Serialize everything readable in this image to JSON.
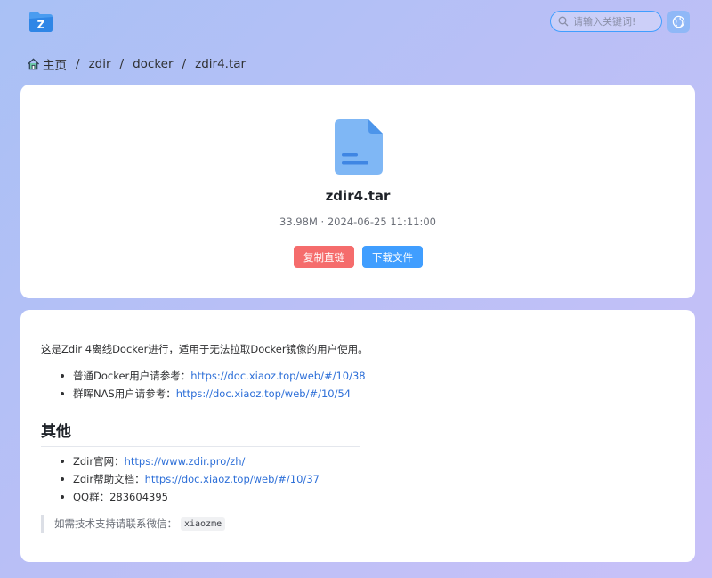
{
  "header": {
    "search_placeholder": "请输入关键词!",
    "logo_letter": "Z"
  },
  "breadcrumb": {
    "home": "主页",
    "items": [
      "zdir",
      "docker",
      "zdir4.tar"
    ],
    "separator": "/"
  },
  "file": {
    "name": "zdir4.tar",
    "meta": "33.98M · 2024-06-25 11:11:00",
    "copy_label": "复制直链",
    "download_label": "下载文件"
  },
  "content": {
    "intro": "这是Zdir 4离线Docker进行，适用于无法拉取Docker镜像的用户使用。",
    "list1": [
      {
        "text": "普通Docker用户请参考：",
        "link": "https://doc.xiaoz.top/web/#/10/38"
      },
      {
        "text": "群晖NAS用户请参考：",
        "link": "https://doc.xiaoz.top/web/#/10/54"
      }
    ],
    "heading": "其他",
    "list2": [
      {
        "text": "Zdir官网：",
        "link": "https://www.zdir.pro/zh/"
      },
      {
        "text": "Zdir帮助文档：",
        "link": "https://doc.xiaoz.top/web/#/10/37"
      },
      {
        "text": "QQ群：",
        "value": "283604395"
      }
    ],
    "quote_text": "如需技术支持请联系微信：",
    "quote_code": "xiaozme"
  },
  "colors": {
    "primary": "#409eff",
    "danger": "#f56c6c",
    "link": "#2d6fd8",
    "file_icon": "#7fb7f5"
  }
}
